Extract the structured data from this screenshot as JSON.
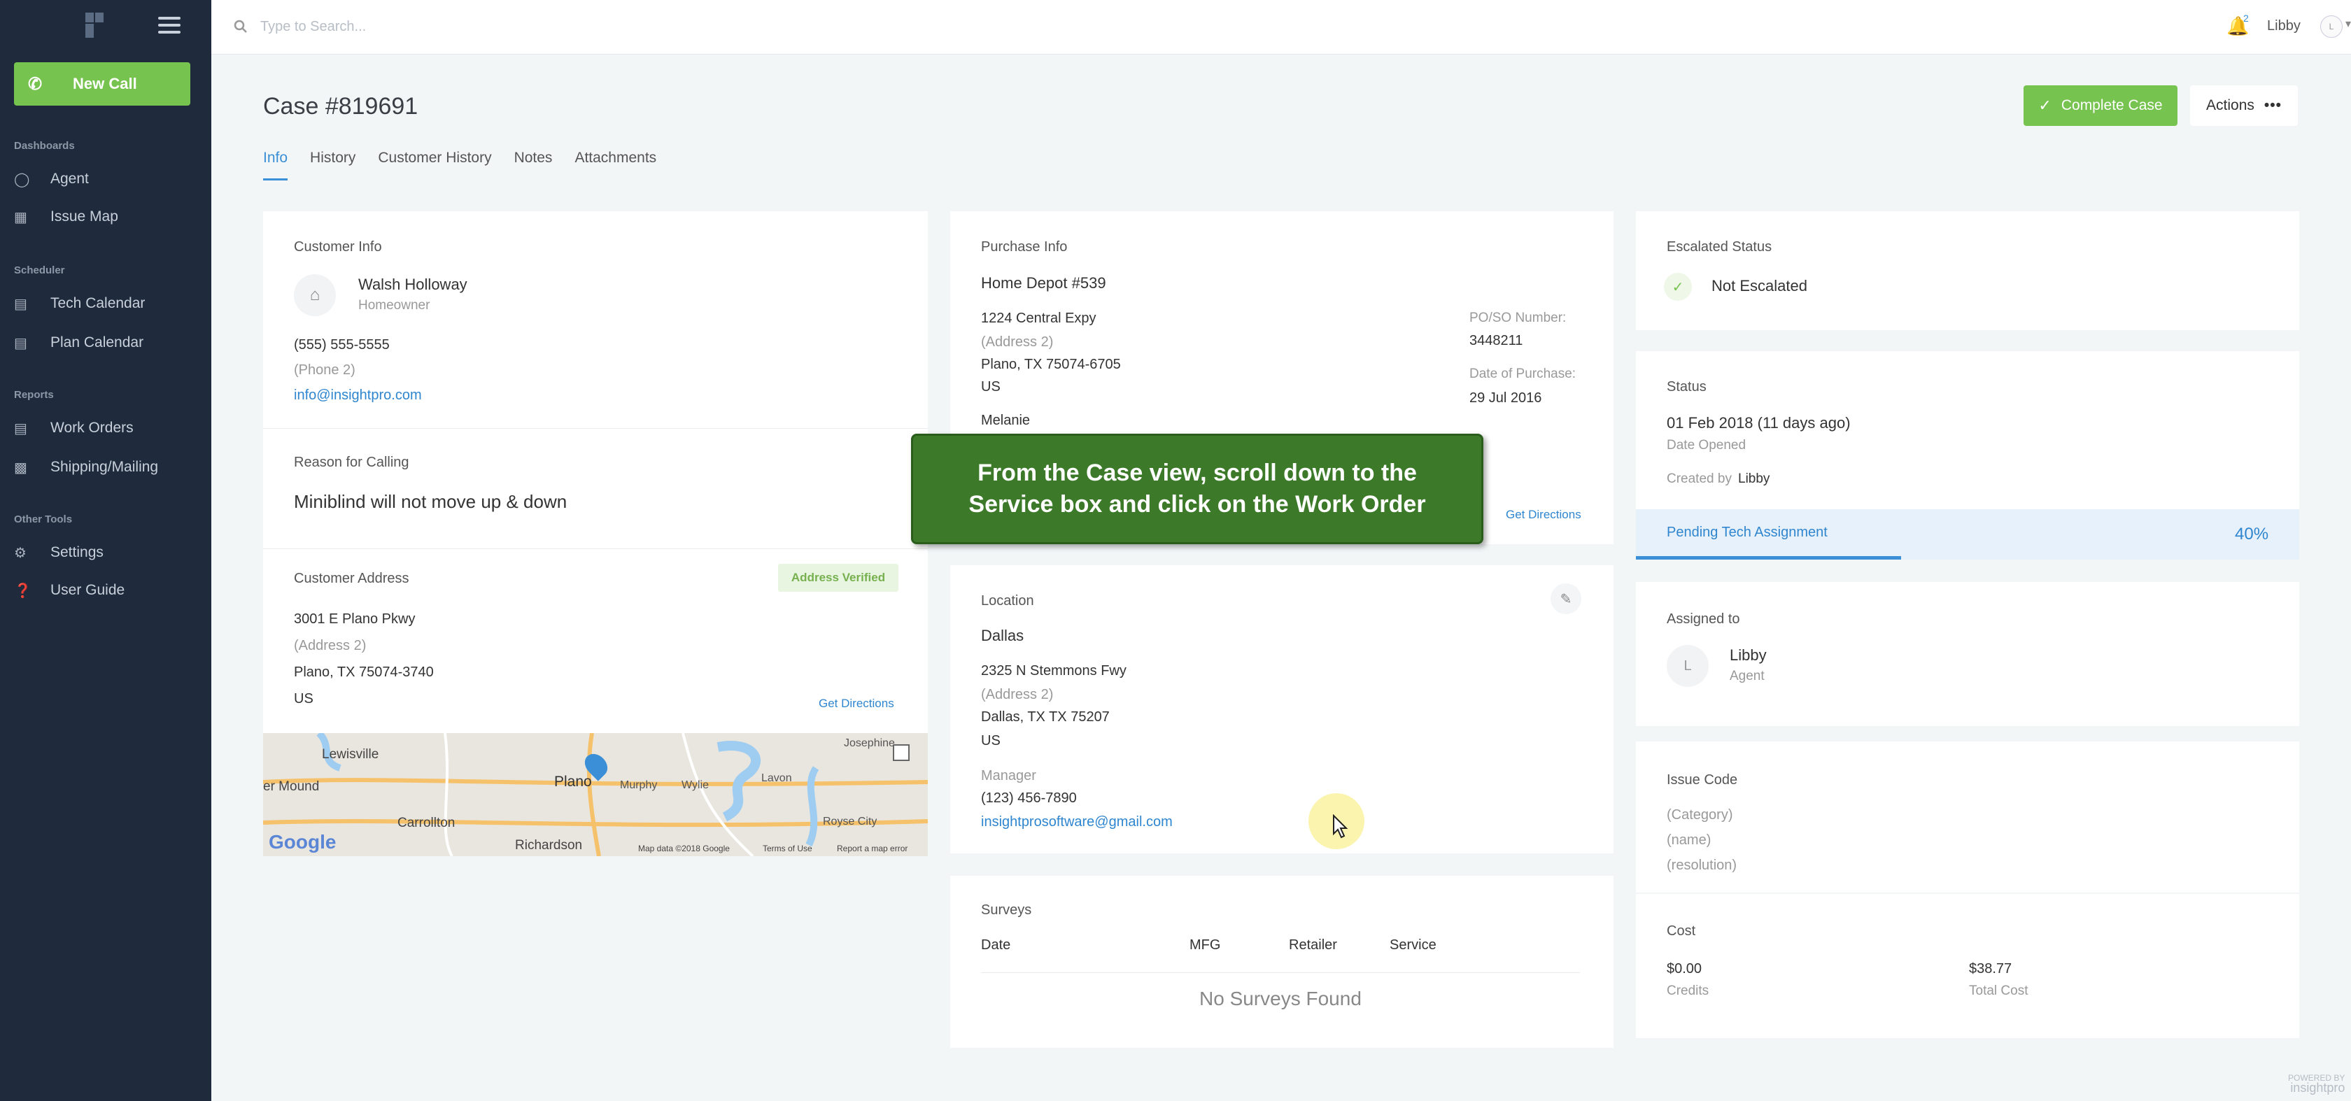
{
  "sidebar": {
    "new_call": "New Call",
    "sections": {
      "dashboards": "Dashboards",
      "scheduler": "Scheduler",
      "reports": "Reports",
      "other": "Other Tools"
    },
    "items": [
      {
        "label": "Agent",
        "icon": "agent-icon"
      },
      {
        "label": "Issue Map",
        "icon": "map-icon"
      },
      {
        "label": "Tech Calendar",
        "icon": "calendar-icon"
      },
      {
        "label": "Plan Calendar",
        "icon": "calendar-icon"
      },
      {
        "label": "Work Orders",
        "icon": "document-icon"
      },
      {
        "label": "Shipping/Mailing",
        "icon": "truck-icon"
      },
      {
        "label": "Settings",
        "icon": "gear-icon"
      },
      {
        "label": "User Guide",
        "icon": "help-icon"
      }
    ]
  },
  "topbar": {
    "search_placeholder": "Type to Search...",
    "notifications": "2",
    "user": "Libby",
    "avatar_initial": "L"
  },
  "header": {
    "title": "Case #819691",
    "complete_label": "Complete Case",
    "actions_label": "Actions",
    "actions_dots": "•••"
  },
  "tabs": [
    "Info",
    "History",
    "Customer History",
    "Notes",
    "Attachments"
  ],
  "customer": {
    "heading": "Customer Info",
    "name": "Walsh Holloway",
    "type": "Homeowner",
    "phone": "(555) 555-5555",
    "phone2": "(Phone 2)",
    "email": "info@insightpro.com",
    "reason_heading": "Reason for Calling",
    "reason": "Miniblind will not move up & down",
    "address_heading": "Customer Address",
    "address_badge": "Address Verified",
    "address1": "3001 E Plano Pkwy",
    "address2": "(Address 2)",
    "city": "Plano, TX 75074-3740",
    "country": "US",
    "directions": "Get Directions"
  },
  "map": {
    "places": [
      "Lewisville",
      "Plano",
      "Murphy",
      "Wylie",
      "Lavon",
      "Josephine",
      "Carrollton",
      "Royse City",
      "Richardson",
      "er Mound"
    ],
    "credits": [
      "Map data ©2018 Google",
      "Terms of Use",
      "Report a map error"
    ],
    "logo": "Google"
  },
  "purchase": {
    "heading": "Purchase Info",
    "store": "Home Depot #539",
    "address1": "1224 Central Expy",
    "address2": "(Address 2)",
    "city": "Plano, TX 75074-6705",
    "country": "US",
    "contact": "Melanie",
    "po_label": "PO/SO Number:",
    "po_value": "3448211",
    "date_label": "Date of Purchase:",
    "date_value": "29 Jul 2016",
    "directions": "Get Directions"
  },
  "location": {
    "heading": "Location",
    "name": "Dallas",
    "address1": "2325 N Stemmons Fwy",
    "address2": "(Address 2)",
    "city": "Dallas, TX TX 75207",
    "country": "US",
    "manager_label": "Manager",
    "phone": "(123) 456-7890",
    "email": "insightprosoftware@gmail.com"
  },
  "surveys": {
    "heading": "Surveys",
    "columns": [
      "Date",
      "MFG",
      "Retailer",
      "Service"
    ],
    "empty": "No Surveys Found"
  },
  "escalated": {
    "heading": "Escalated Status",
    "value": "Not Escalated"
  },
  "status": {
    "heading": "Status",
    "date": "01 Feb 2018 (11 days ago)",
    "date_label": "Date Opened",
    "created_prefix": "Created by",
    "created_by": "Libby",
    "progress_label": "Pending Tech Assignment",
    "progress_percent": "40%",
    "progress_value": 0.4
  },
  "assigned": {
    "heading": "Assigned to",
    "initial": "L",
    "name": "Libby",
    "role": "Agent"
  },
  "issue": {
    "heading": "Issue Code",
    "category": "(Category)",
    "name": "(name)",
    "resolution": "(resolution)"
  },
  "cost": {
    "heading": "Cost",
    "credits_value": "$0.00",
    "credits_label": "Credits",
    "total_value": "$38.77",
    "total_label": "Total Cost"
  },
  "tooltip": {
    "line1": "From the Case view, scroll down to the",
    "line2": "Service box and click on the Work Order"
  },
  "footer": {
    "powered": "POWERED BY",
    "brand": "insightpro"
  },
  "colors": {
    "sidebar": "#1f2a3c",
    "accent_green": "#77c34f",
    "link_blue": "#2f86cf",
    "tooltip_green": "#3c7a2a"
  }
}
